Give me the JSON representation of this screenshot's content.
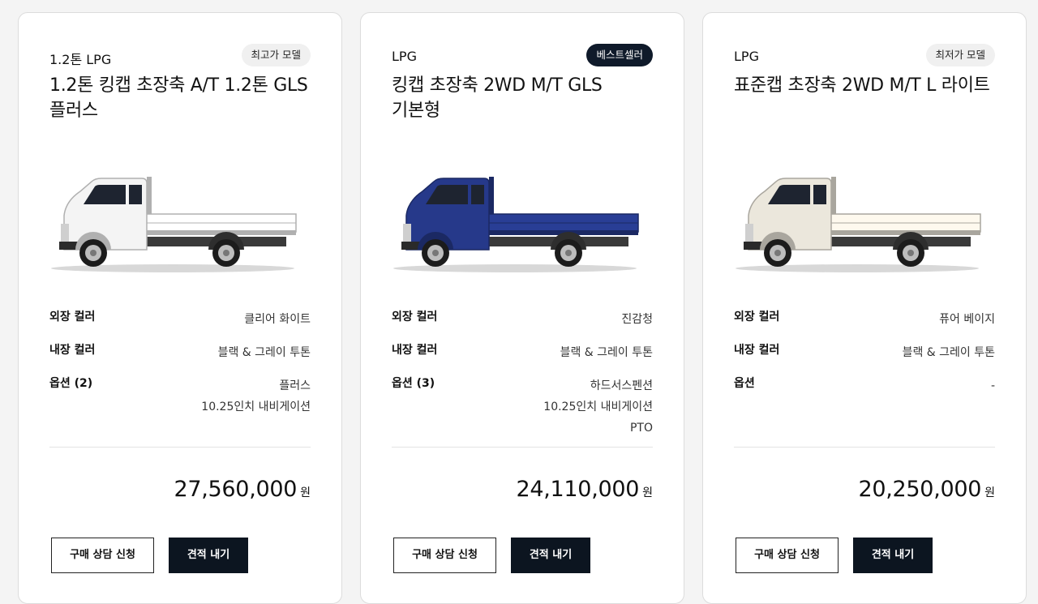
{
  "cards": [
    {
      "fuel": "1.2톤 LPG",
      "badge": "최고가 모델",
      "badge_style": "grey",
      "model_line1": "1.2톤 킹캡 초장축 A/T 1.2톤 GLS",
      "model_line2": "플러스",
      "truck_color": "#f4f4f4",
      "truck_color_name": "white",
      "specs": {
        "exterior_label": "외장 컬러",
        "exterior_value": "클리어 화이트",
        "interior_label": "내장 컬러",
        "interior_value": "블랙 & 그레이 투톤",
        "options_label": "옵션 (2)",
        "options": [
          "플러스",
          "10.25인치 내비게이션"
        ]
      },
      "price": "27,560,000",
      "currency": "원",
      "consult_label": "구매 상담 신청",
      "quote_label": "견적 내기"
    },
    {
      "fuel": "LPG",
      "badge": "베스트셀러",
      "badge_style": "dark",
      "model_line1": "킹캡 초장축 2WD M/T GLS",
      "model_line2": "기본형",
      "truck_color": "#26398a",
      "truck_color_name": "deep blue",
      "specs": {
        "exterior_label": "외장 컬러",
        "exterior_value": "진감청",
        "interior_label": "내장 컬러",
        "interior_value": "블랙 & 그레이 투톤",
        "options_label": "옵션 (3)",
        "options": [
          "하드서스펜션",
          "10.25인치 내비게이션",
          "PTO"
        ]
      },
      "price": "24,110,000",
      "currency": "원",
      "consult_label": "구매 상담 신청",
      "quote_label": "견적 내기"
    },
    {
      "fuel": "LPG",
      "badge": "최저가 모델",
      "badge_style": "grey",
      "model_line1": "표준캡 초장축 2WD M/T L 라이트",
      "model_line2": "",
      "truck_color": "#ebe7dc",
      "truck_color_name": "beige",
      "specs": {
        "exterior_label": "외장 컬러",
        "exterior_value": "퓨어 베이지",
        "interior_label": "내장 컬러",
        "interior_value": "블랙 & 그레이 투톤",
        "options_label": "옵션",
        "options": [
          "-"
        ]
      },
      "price": "20,250,000",
      "currency": "원",
      "consult_label": "구매 상담 신청",
      "quote_label": "견적 내기"
    }
  ]
}
